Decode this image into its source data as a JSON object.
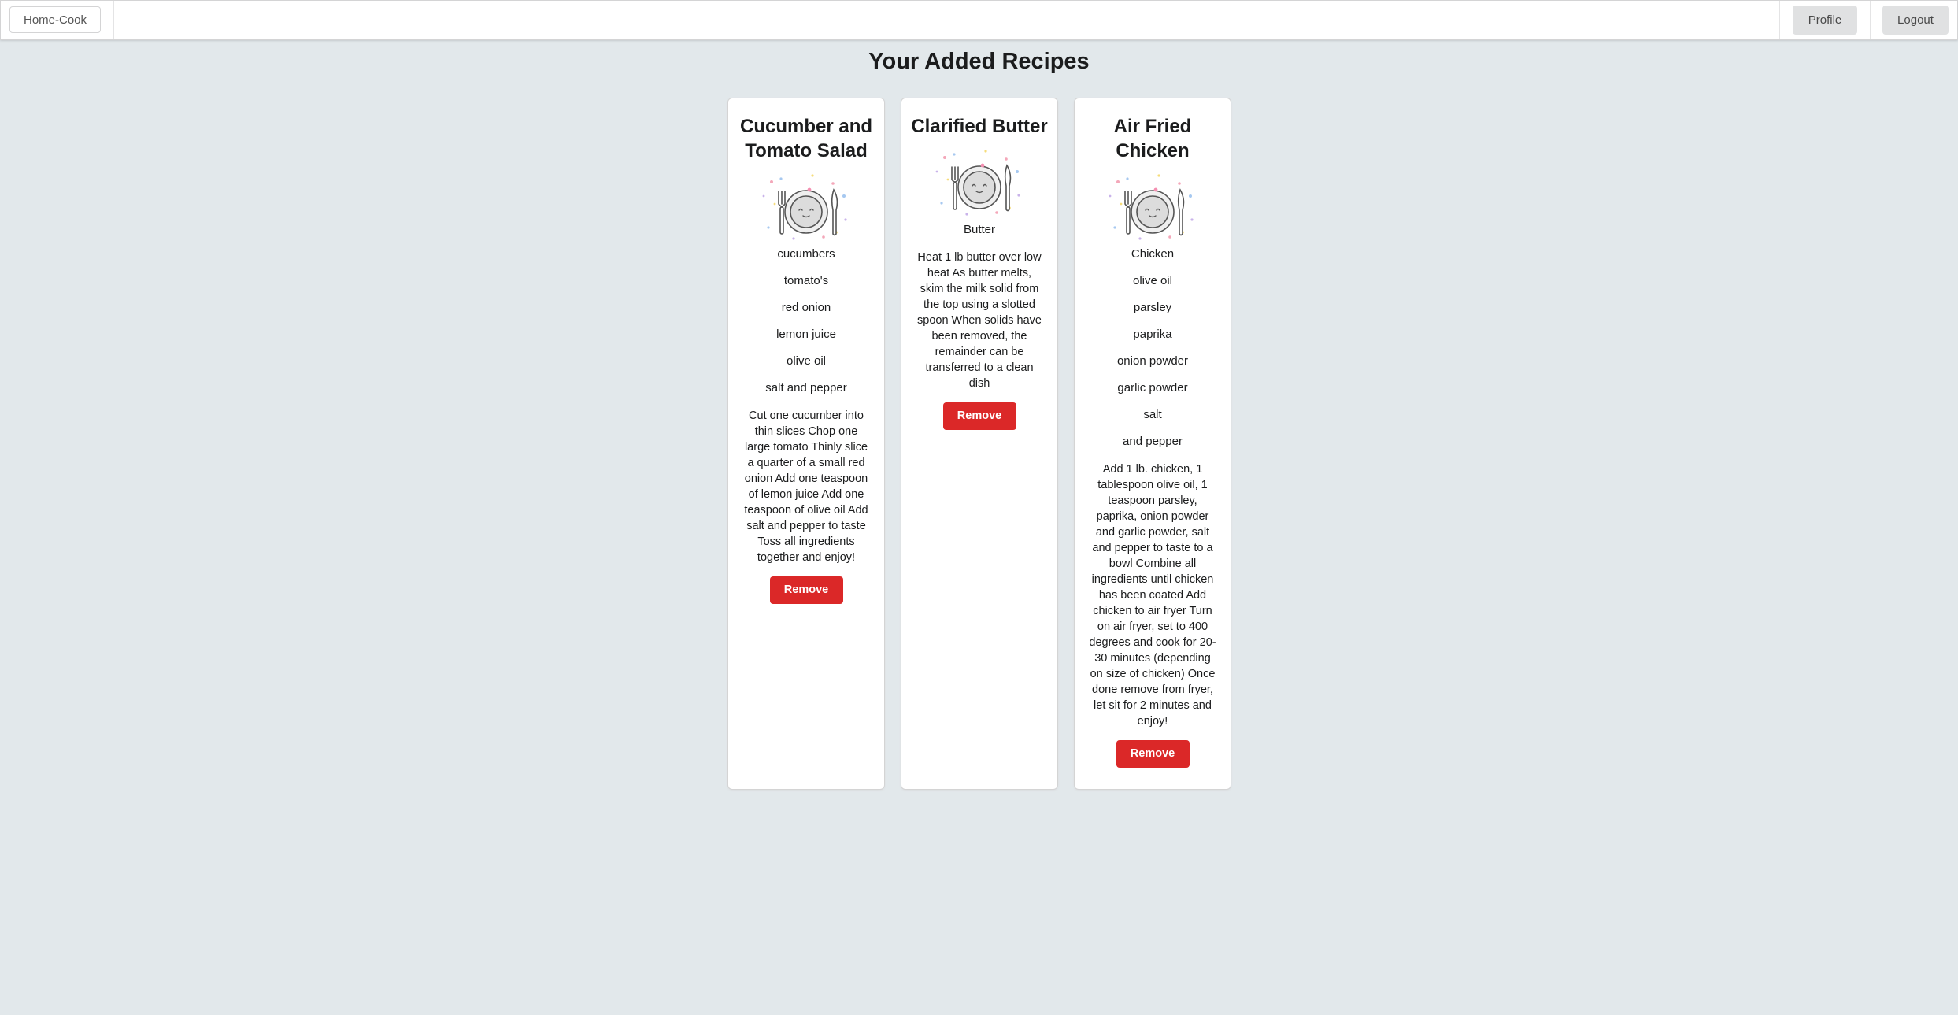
{
  "navbar": {
    "brand": "Home-Cook",
    "profile_label": "Profile",
    "logout_label": "Logout"
  },
  "page": {
    "title": "Your Added Recipes"
  },
  "colors": {
    "background": "#e2e8eb",
    "remove_button": "#db2828",
    "nav_button": "#e0e1e2"
  },
  "recipes": [
    {
      "title": "Cucumber and Tomato Salad",
      "image_icon": "plate-with-cutlery-icon",
      "ingredients": [
        "cucumbers",
        "tomato's",
        "red onion",
        "lemon juice",
        "olive oil",
        "salt and pepper"
      ],
      "instructions": "Cut one cucumber into thin slices Chop one large tomato Thinly slice a quarter of a small red onion Add one teaspoon of lemon juice Add one teaspoon of olive oil Add salt and pepper to taste Toss all ingredients together and enjoy!",
      "remove_label": "Remove"
    },
    {
      "title": "Clarified Butter",
      "image_icon": "plate-with-cutlery-icon",
      "ingredients": [
        "Butter"
      ],
      "instructions": "Heat 1 lb butter over low heat As butter melts, skim the milk solid from the top using a slotted spoon When solids have been removed, the remainder can be transferred to a clean dish",
      "remove_label": "Remove"
    },
    {
      "title": "Air Fried Chicken",
      "image_icon": "plate-with-cutlery-icon",
      "ingredients": [
        "Chicken",
        "olive oil",
        "parsley",
        "paprika",
        "onion powder",
        "garlic powder",
        "salt",
        "and pepper"
      ],
      "instructions": "Add 1 lb. chicken, 1 tablespoon olive oil, 1 teaspoon parsley, paprika, onion powder and garlic powder, salt and pepper to taste to a bowl Combine all ingredients until chicken has been coated Add chicken to air fryer Turn on air fryer, set to 400 degrees and cook for 20-30 minutes (depending on size of chicken) Once done remove from fryer, let sit for 2 minutes and enjoy!",
      "remove_label": "Remove"
    }
  ]
}
